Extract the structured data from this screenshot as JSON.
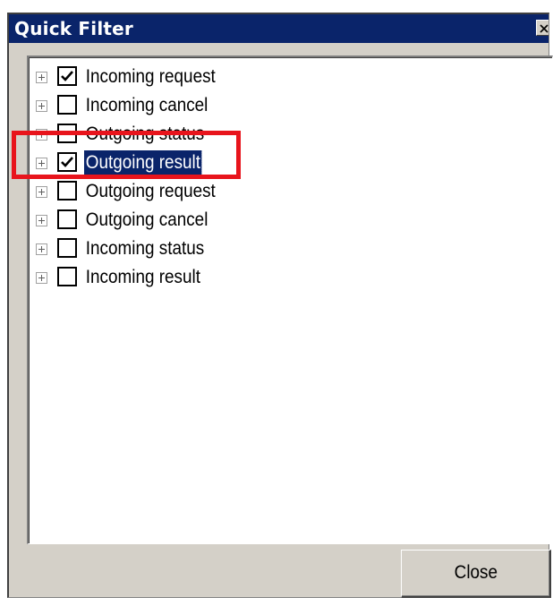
{
  "window": {
    "title": "Quick Filter"
  },
  "tree": {
    "items": [
      {
        "label": "Incoming request",
        "checked": true,
        "selected": false,
        "expander": "plus-expander-icon"
      },
      {
        "label": "Incoming cancel",
        "checked": false,
        "selected": false,
        "expander": "plus-expander-icon"
      },
      {
        "label": "Outgoing status",
        "checked": false,
        "selected": false,
        "expander": "plus-expander-icon"
      },
      {
        "label": "Outgoing result",
        "checked": true,
        "selected": true,
        "expander": "plus-expander-icon"
      },
      {
        "label": "Outgoing request",
        "checked": false,
        "selected": false,
        "expander": "plus-expander-icon"
      },
      {
        "label": "Outgoing cancel",
        "checked": false,
        "selected": false,
        "expander": "plus-expander-icon"
      },
      {
        "label": "Incoming status",
        "checked": false,
        "selected": false,
        "expander": "plus-expander-icon"
      },
      {
        "label": "Incoming result",
        "checked": false,
        "selected": false,
        "expander": "plus-expander-icon"
      }
    ]
  },
  "footer": {
    "close_label": "Close"
  },
  "colors": {
    "titlebar": "#0a246a",
    "dialog_face": "#d4d0c8",
    "selection": "#0a246a",
    "annotation_highlight": "#e8141c"
  }
}
